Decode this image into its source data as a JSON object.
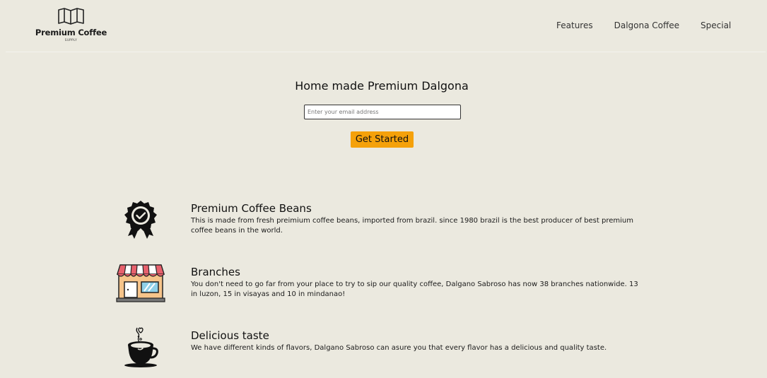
{
  "brand": {
    "name": "Premium Coffee",
    "tagline": "SUPPLY",
    "icon": "folded-map-icon"
  },
  "nav": {
    "items": [
      {
        "label": "Features"
      },
      {
        "label": "Dalgona Coffee"
      },
      {
        "label": "Special"
      }
    ]
  },
  "hero": {
    "title": "Home made Premium Dalgona",
    "email_placeholder": "Enter your email address",
    "cta_label": "Get Started",
    "cta_color": "#f5a10a"
  },
  "features": [
    {
      "icon": "badge-check-icon",
      "title": "Premium Coffee Beans",
      "description": "This is made from fresh preimium coffee beans, imported from brazil. since 1980 brazil is the best producer of best premium coffee beans in the world."
    },
    {
      "icon": "storefront-icon",
      "title": "Branches",
      "description": "You don't need to go far from your place to try to sip our quality coffee, Dalgano Sabroso has now 38 branches nationwide. 13 in luzon, 15 in visayas and 10 in mindanao!"
    },
    {
      "icon": "coffee-cup-icon",
      "title": "Delicious taste",
      "description": "We have different kinds of flavors, Dalgano Sabroso can asure you that every flavor has a delicious and quality taste."
    }
  ],
  "colors": {
    "background": "#ebe9df",
    "accent": "#f5a10a"
  }
}
